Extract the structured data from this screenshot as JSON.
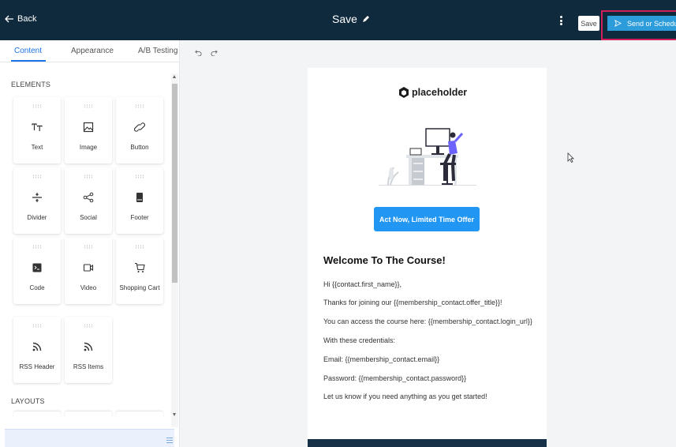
{
  "header": {
    "back_label": "Back",
    "title": "Save",
    "save_label": "Save",
    "send_label": "Send or Schedule"
  },
  "tabs": [
    {
      "label": "Content",
      "active": true
    },
    {
      "label": "Appearance",
      "active": false
    },
    {
      "label": "A/B Testing",
      "active": false
    }
  ],
  "sections": {
    "elements": "ELEMENTS",
    "layouts": "LAYOUTS"
  },
  "elements": [
    {
      "label": "Text",
      "icon": "text-icon"
    },
    {
      "label": "Image",
      "icon": "image-icon"
    },
    {
      "label": "Button",
      "icon": "link-icon"
    },
    {
      "label": "Divider",
      "icon": "divider-icon"
    },
    {
      "label": "Social",
      "icon": "share-icon"
    },
    {
      "label": "Footer",
      "icon": "footer-icon"
    },
    {
      "label": "Code",
      "icon": "code-icon"
    },
    {
      "label": "Video",
      "icon": "video-icon"
    },
    {
      "label": "Shopping Cart",
      "icon": "cart-icon"
    },
    {
      "label": "RSS Header",
      "icon": "rss-icon"
    },
    {
      "label": "RSS Items",
      "icon": "rss-icon"
    }
  ],
  "email": {
    "logo_text": "placeholder",
    "cta_label": "Act Now, Limited Time Offer",
    "heading": "Welcome To The Course!",
    "paragraphs": [
      "Hi {{contact.first_name}},",
      "Thanks for joining our {{membership_contact.offer_title}}!",
      "You can access the course here: {{membership_contact.login_url}}",
      "With these credentials:",
      "Email: {{membership_contact.email}}",
      "Password: {{membership_contact.password}}",
      "Let us know if you need anything as you get started!"
    ]
  },
  "colors": {
    "topbar": "#0f2a3d",
    "accent": "#2196f3",
    "send_button": "#2d9cdb",
    "highlight": "#d0205a"
  }
}
